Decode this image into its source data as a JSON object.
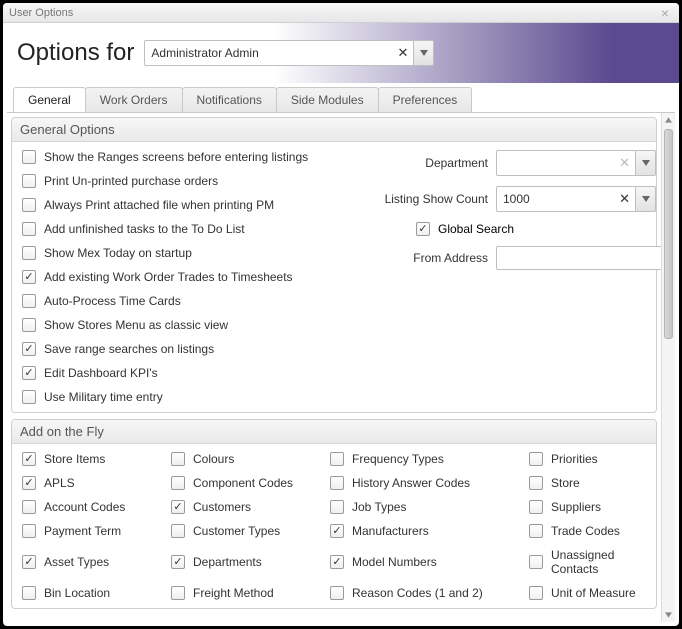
{
  "window_title": "User Options",
  "header": {
    "title": "Options for",
    "user": "Administrator Admin"
  },
  "tabs": [
    "General",
    "Work Orders",
    "Notifications",
    "Side Modules",
    "Preferences"
  ],
  "active_tab": 0,
  "group_general_title": "General Options",
  "left_options": [
    {
      "label": "Show the Ranges screens before entering listings",
      "checked": false
    },
    {
      "label": "Print Un-printed purchase orders",
      "checked": false
    },
    {
      "label": "Always Print attached file when printing PM",
      "checked": false
    },
    {
      "label": "Add unfinished tasks to the To Do List",
      "checked": false
    },
    {
      "label": "Show Mex Today on startup",
      "checked": false
    },
    {
      "label": "Add existing Work Order Trades to Timesheets",
      "checked": true
    },
    {
      "label": "Auto-Process Time Cards",
      "checked": false
    },
    {
      "label": "Show Stores Menu as classic view",
      "checked": false
    },
    {
      "label": "Save range searches on listings",
      "checked": true
    },
    {
      "label": "Edit Dashboard KPI's",
      "checked": true
    },
    {
      "label": "Use Military time entry",
      "checked": false
    }
  ],
  "right_fields": {
    "department_label": "Department",
    "department_value": "",
    "listing_label": "Listing Show Count",
    "listing_value": "1000",
    "global_search_label": "Global Search",
    "global_search_checked": true,
    "from_address_label": "From Address",
    "from_address_value": ""
  },
  "group_fly_title": "Add on the Fly",
  "fly_items": [
    {
      "label": "Store Items",
      "checked": true
    },
    {
      "label": "Colours",
      "checked": false
    },
    {
      "label": "Frequency Types",
      "checked": false
    },
    {
      "label": "Priorities",
      "checked": false
    },
    {
      "label": "APLS",
      "checked": true
    },
    {
      "label": "Component Codes",
      "checked": false
    },
    {
      "label": "History Answer Codes",
      "checked": false
    },
    {
      "label": "Store",
      "checked": false
    },
    {
      "label": "Account Codes",
      "checked": false
    },
    {
      "label": "Customers",
      "checked": true
    },
    {
      "label": "Job Types",
      "checked": false
    },
    {
      "label": "Suppliers",
      "checked": false
    },
    {
      "label": "Payment Term",
      "checked": false
    },
    {
      "label": "Customer Types",
      "checked": false
    },
    {
      "label": "Manufacturers",
      "checked": true
    },
    {
      "label": "Trade Codes",
      "checked": false
    },
    {
      "label": "Asset Types",
      "checked": true
    },
    {
      "label": "Departments",
      "checked": true
    },
    {
      "label": "Model Numbers",
      "checked": true
    },
    {
      "label": "Unassigned Contacts",
      "checked": false
    },
    {
      "label": "Bin Location",
      "checked": false
    },
    {
      "label": "Freight Method",
      "checked": false
    },
    {
      "label": "Reason Codes (1 and 2)",
      "checked": false
    },
    {
      "label": "Unit of Measure",
      "checked": false
    }
  ]
}
